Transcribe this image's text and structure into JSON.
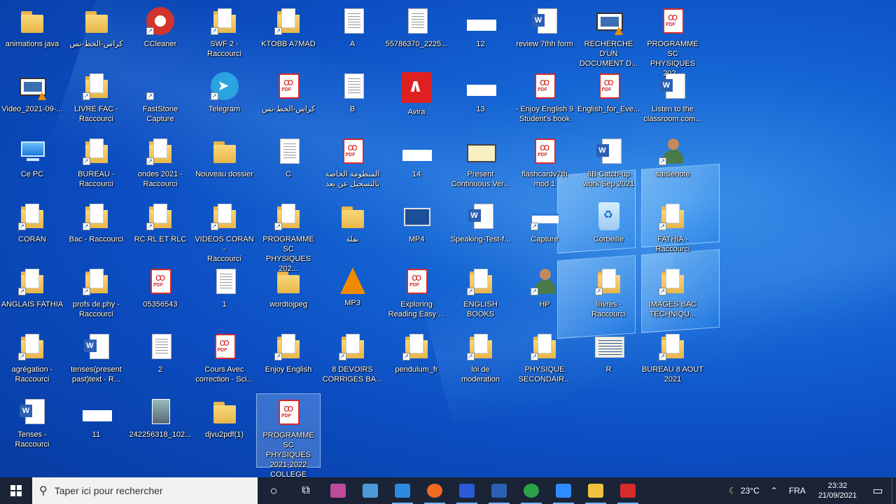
{
  "desktop": {
    "icons": [
      {
        "label": "animations java",
        "type": "folder"
      },
      {
        "label": "كراس-الخط-نس",
        "type": "folder"
      },
      {
        "label": "CCleaner",
        "type": "ccleaner"
      },
      {
        "label": "SWF 2 -\nRaccourci",
        "type": "fdocs"
      },
      {
        "label": "KTOBB A7MAD",
        "type": "fdocs"
      },
      {
        "label": "A",
        "type": "doc"
      },
      {
        "label": "55786370_2225...",
        "type": "doc"
      },
      {
        "label": "12",
        "type": "blank"
      },
      {
        "label": "review 7thh form",
        "type": "word"
      },
      {
        "label": "RECHERCHE D'UN\nDOCUMENT D...",
        "type": "video"
      },
      {
        "label": "PROGRAMME SC\nPHYSIQUES 202...",
        "type": "pdf"
      },
      {
        "label": "Video_2021-09-...",
        "type": "video"
      },
      {
        "label": "LIVRE FAC -\nRaccourci",
        "type": "fdocs"
      },
      {
        "label": "FastStone\nCapture",
        "type": "faststone"
      },
      {
        "label": "Telegram",
        "type": "telegram"
      },
      {
        "label": "كراس-الخط-نس",
        "type": "pdf"
      },
      {
        "label": "B",
        "type": "doc"
      },
      {
        "label": "Avira",
        "type": "avira"
      },
      {
        "label": "13",
        "type": "blank"
      },
      {
        "label": "- Enjoy English 9\nStudent's book",
        "type": "pdf"
      },
      {
        "label": "English_for_Eve...",
        "type": "pdf"
      },
      {
        "label": "Listen to the\nclassroom com...",
        "type": "word"
      },
      {
        "label": "Ce PC",
        "type": "pc"
      },
      {
        "label": "BUREAU -\nRaccourci",
        "type": "fdocs"
      },
      {
        "label": "ondes 2021 -\nRaccourci",
        "type": "fdocs"
      },
      {
        "label": "Nouveau dossier",
        "type": "folder"
      },
      {
        "label": "C",
        "type": "doc"
      },
      {
        "label": "المنظومة الخاصة\nبالتسجيل عن بعد",
        "type": "pdf"
      },
      {
        "label": "14",
        "type": "blank"
      },
      {
        "label": "Present\nContinuous Ver...",
        "type": "present"
      },
      {
        "label": "flashcardv7th\nmod 1",
        "type": "pdf"
      },
      {
        "label": "8B Catch-up\nwork Sep 2021",
        "type": "word"
      },
      {
        "label": "saisienote",
        "type": "user"
      },
      {
        "label": "CORAN",
        "type": "fdocs"
      },
      {
        "label": "Bac - Raccourci",
        "type": "fdocs"
      },
      {
        "label": "RC RL ET RLC",
        "type": "fdocs"
      },
      {
        "label": "VIDEOS CORAN -\nRaccourci",
        "type": "fdocs"
      },
      {
        "label": "PROGRAMME SC\nPHYSIQUES 202...",
        "type": "fdocs"
      },
      {
        "label": "نقلة",
        "type": "folder"
      },
      {
        "label": "MP4",
        "type": "mp4"
      },
      {
        "label": "Speaking-Test-f...",
        "type": "word"
      },
      {
        "label": "Capture",
        "type": "capture"
      },
      {
        "label": "Corbeille",
        "type": "bin"
      },
      {
        "label": "FATHIA -\nRaccourci",
        "type": "fdocs"
      },
      {
        "label": "ANGLAIS FATHIA",
        "type": "fdocs"
      },
      {
        "label": "profs de.phy -\nRaccourci",
        "type": "fdocs"
      },
      {
        "label": "05356543",
        "type": "pdf"
      },
      {
        "label": "1",
        "type": "doc"
      },
      {
        "label": "wordtojpeg",
        "type": "folder"
      },
      {
        "label": "MP3",
        "type": "vlc"
      },
      {
        "label": "Exploring\nReading Easy ...",
        "type": "pdf"
      },
      {
        "label": "ENGLISH BOOKS",
        "type": "fdocs"
      },
      {
        "label": "HP",
        "type": "user"
      },
      {
        "label": "liiivres -\nRaccourci",
        "type": "fdocs"
      },
      {
        "label": "IMAGES BAC\nTECHNIQU...",
        "type": "fdocs"
      },
      {
        "label": "agrégation -\nRaccourci",
        "type": "fdocs"
      },
      {
        "label": "tenses(present\npast)text - R...",
        "type": "word"
      },
      {
        "label": "2",
        "type": "doc"
      },
      {
        "label": "Cours Avec\ncorrection - Sci...",
        "type": "pdf"
      },
      {
        "label": "Enjoy English",
        "type": "fdocs"
      },
      {
        "label": "8 DEVOIRS\nCORRIGES BA...",
        "type": "fdocs"
      },
      {
        "label": "pendulum_fr",
        "type": "fdocs"
      },
      {
        "label": "loi de\nmoderation",
        "type": "fdocs"
      },
      {
        "label": "PHYSIQUE\nSECONDAIR...",
        "type": "fdocs"
      },
      {
        "label": "R",
        "type": "scan"
      },
      {
        "label": "BUREAU 8 AOUT\n2021",
        "type": "fdocs"
      },
      {
        "label": "Tenses -\nRaccourci",
        "type": "word"
      },
      {
        "label": "11",
        "type": "blank"
      },
      {
        "label": "242256318_102...",
        "type": "img"
      },
      {
        "label": "djvu2pdf(1)",
        "type": "folder"
      },
      {
        "label": "PROGRAMME SC\nPHYSIQUES\n2021-2022\nCOLLEGE",
        "type": "pdf"
      }
    ]
  },
  "taskbar": {
    "search_placeholder": "Taper ici pour rechercher",
    "pinned_apps": [
      {
        "name": "task-view",
        "color": "#ffffff"
      },
      {
        "name": "multitask",
        "color": "#ffffff"
      },
      {
        "name": "winrar",
        "color": "#c04a9a"
      },
      {
        "name": "remote-desktop",
        "color": "#4a9ad8"
      },
      {
        "name": "mail",
        "color": "#2a8ae0"
      },
      {
        "name": "firefox",
        "color": "#f06a20"
      },
      {
        "name": "app-blue",
        "color": "#2a5ad8"
      },
      {
        "name": "word",
        "color": "#2b5fb4"
      },
      {
        "name": "chrome",
        "color": "#2da04a"
      },
      {
        "name": "zoom",
        "color": "#2d8cff"
      },
      {
        "name": "file-explorer",
        "color": "#f0c040"
      },
      {
        "name": "acrobat",
        "color": "#d72a2a"
      }
    ],
    "tray": {
      "temperature": "23°C",
      "language": "FRA",
      "time": "23:32",
      "date": "21/09/2021"
    }
  }
}
